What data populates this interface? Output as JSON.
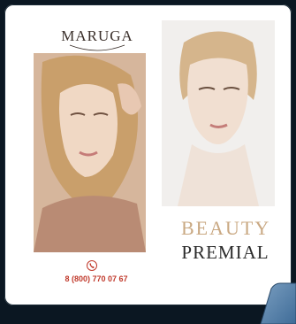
{
  "brand": {
    "logo": "MARUGA",
    "name_line1": "BEAUTY",
    "name_line2": "PREMIAL"
  },
  "contact": {
    "phone": "8 (800) 770 07 67",
    "phone_icon": "phone-icon"
  },
  "colors": {
    "background": "#0b1722",
    "panel": "#ffffff",
    "accent": "#c0392b",
    "gold": "#c9a882"
  }
}
